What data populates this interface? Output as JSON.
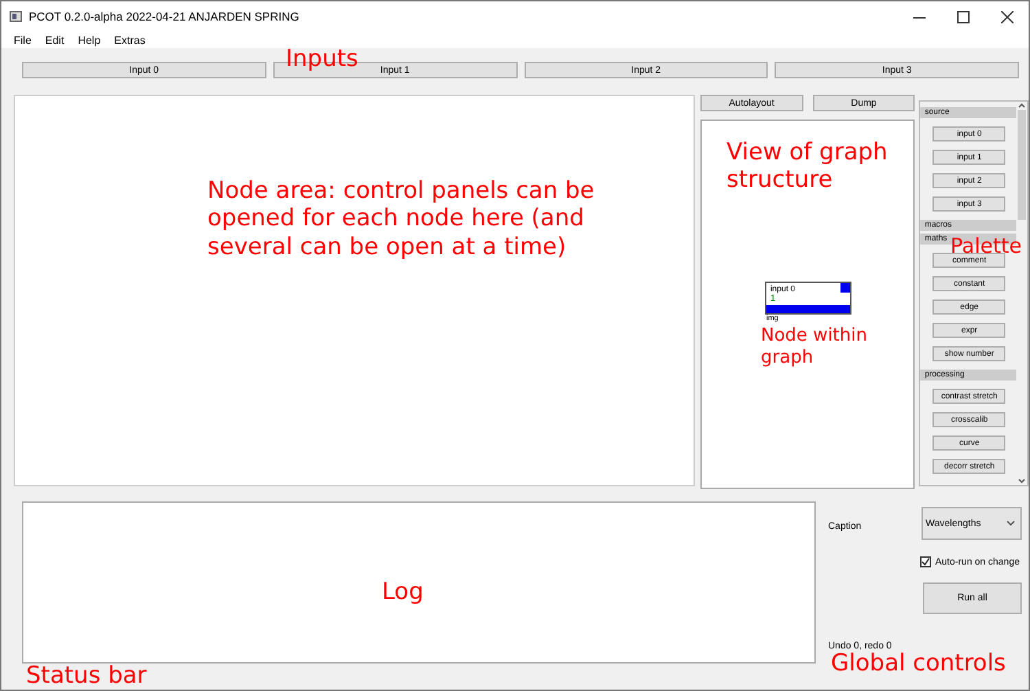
{
  "window": {
    "title": "PCOT 0.2.0-alpha 2022-04-21 ANJARDEN SPRING"
  },
  "menu": [
    "File",
    "Edit",
    "Help",
    "Extras"
  ],
  "inputs": [
    "Input 0",
    "Input 1",
    "Input 2",
    "Input 3"
  ],
  "graph_buttons": [
    "Autolayout",
    "Dump"
  ],
  "graph": {
    "nodes": [
      {
        "title": "input 0",
        "count": "1",
        "output": "img"
      }
    ]
  },
  "palette": {
    "groups": [
      {
        "name": "source",
        "items": [
          "input 0",
          "input 1",
          "input 2",
          "input 3"
        ]
      },
      {
        "name": "macros"
      },
      {
        "name": "maths",
        "items": [
          "comment",
          "constant",
          "edge",
          "expr",
          "show number"
        ]
      },
      {
        "name": "processing",
        "items": [
          "contrast stretch",
          "crosscalib",
          "curve",
          "decorr stretch"
        ]
      }
    ]
  },
  "controls": {
    "caption_label": "Caption",
    "caption_value": "Wavelengths",
    "auto_run": {
      "label": "Auto-run on change",
      "checked": true
    },
    "run_button": "Run all",
    "undo_status": "Undo 0, redo 0"
  },
  "annotations": [
    {
      "kind": "label",
      "text": "Inputs"
    },
    {
      "kind": "label",
      "text": "Node area: control panels can be opened for each node here (and several can be open at a time)"
    },
    {
      "kind": "label",
      "text": "View of graph structure"
    },
    {
      "kind": "small",
      "text": "Node within graph"
    },
    {
      "kind": "label",
      "text": "Palette"
    },
    {
      "kind": "label",
      "text": "Log"
    },
    {
      "kind": "label",
      "text": "Status bar"
    },
    {
      "kind": "label",
      "text": "Global controls"
    }
  ]
}
